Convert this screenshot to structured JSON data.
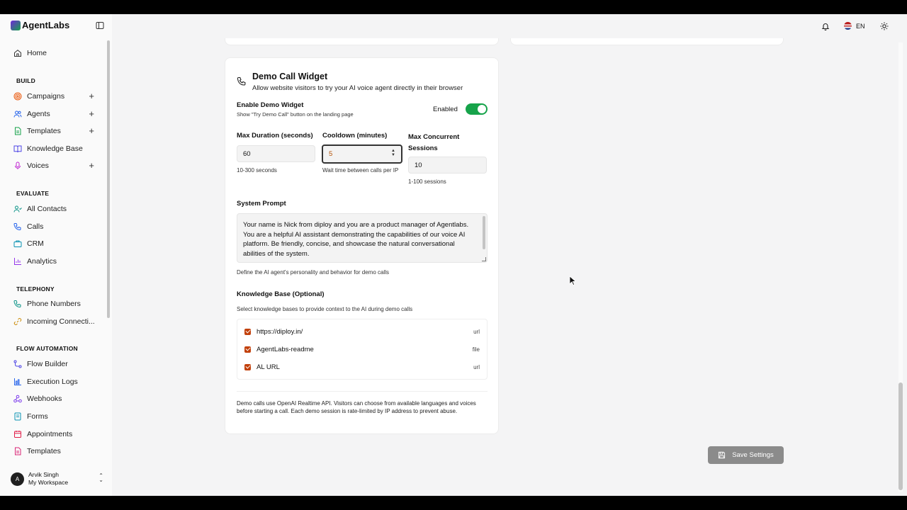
{
  "sidebar": {
    "brand": "AgentLabs",
    "home": "Home",
    "sections": {
      "build": "BUILD",
      "evaluate": "EVALUATE",
      "telephony": "TELEPHONY",
      "flow": "FLOW AUTOMATION"
    },
    "build_items": [
      "Campaigns",
      "Agents",
      "Templates",
      "Knowledge Base",
      "Voices"
    ],
    "evaluate_items": [
      "All Contacts",
      "Calls",
      "CRM",
      "Analytics"
    ],
    "telephony_items": [
      "Phone Numbers",
      "Incoming Connecti..."
    ],
    "flow_items": [
      "Flow Builder",
      "Execution Logs",
      "Webhooks",
      "Forms",
      "Appointments",
      "Templates"
    ],
    "user": {
      "initial": "A",
      "name": "Arvik Singh",
      "workspace": "My Workspace"
    }
  },
  "topbar": {
    "language": "EN"
  },
  "widget": {
    "title": "Demo Call Widget",
    "subtitle": "Allow website visitors to try your AI voice agent directly in their browser",
    "enable_label": "Enable Demo Widget",
    "enable_hint": "Show \"Try Demo Call\" button on the landing page",
    "toggle_state": "Enabled",
    "max_duration": {
      "label": "Max Duration (seconds)",
      "value": "60",
      "hint": "10-300 seconds"
    },
    "cooldown": {
      "label": "Cooldown (minutes)",
      "value": "5",
      "hint": "Wait time between calls per IP"
    },
    "max_sessions": {
      "label": "Max Concurrent Sessions",
      "value": "10",
      "hint": "1-100 sessions"
    },
    "system_prompt": {
      "label": "System Prompt",
      "value": "Your name is Nick from diploy and you are a product manager of Agentlabs. You are a helpful AI assistant demonstrating the capabilities of our voice AI platform. Be friendly, concise, and showcase the natural conversational abilities of the system.",
      "hint": "Define the AI agent's personality and behavior for demo calls"
    },
    "knowledge_base": {
      "label": "Knowledge Base (Optional)",
      "hint": "Select knowledge bases to provide context to the AI during demo calls",
      "items": [
        {
          "name": "https://diploy.in/",
          "type": "url"
        },
        {
          "name": "AgentLabs-readme",
          "type": "file"
        },
        {
          "name": "AL URL",
          "type": "url"
        }
      ]
    },
    "footnote": "Demo calls use OpenAI Realtime API. Visitors can choose from available languages and voices before starting a call. Each demo session is rate-limited by IP address to prevent abuse."
  },
  "save_button": "Save Settings",
  "colors": {
    "accent": "#16a34a",
    "checkbox": "#c2410c",
    "save_disabled": "#8b8b8b"
  }
}
